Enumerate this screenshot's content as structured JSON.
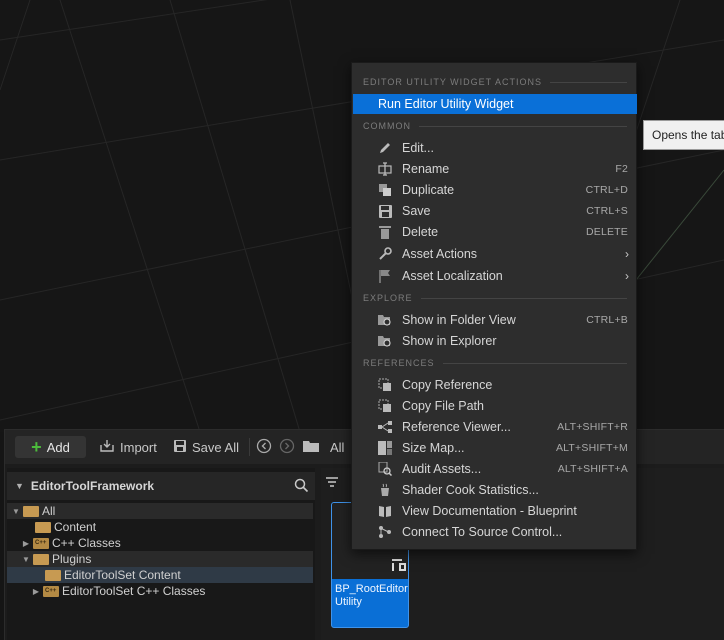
{
  "toolbar": {
    "add_label": "Add",
    "import_label": "Import",
    "save_all_label": "Save All",
    "path_label": "All"
  },
  "tree": {
    "title": "EditorToolFramework",
    "items": [
      {
        "label": "All"
      },
      {
        "label": "Content"
      },
      {
        "label": "C++ Classes"
      },
      {
        "label": "Plugins"
      },
      {
        "label": "EditorToolSet Content"
      },
      {
        "label": "EditorToolSet C++ Classes"
      }
    ]
  },
  "asset": {
    "name": "BP_RootEditorUtility",
    "name_line1": "BP_RootEditor",
    "name_line2": "Utility"
  },
  "menu": {
    "sections": {
      "widget_actions": "EDITOR UTILITY WIDGET ACTIONS",
      "common": "COMMON",
      "explore": "EXPLORE",
      "references": "REFERENCES"
    },
    "run_widget": "Run Editor Utility Widget",
    "common": [
      {
        "label": "Edit...",
        "shortcut": "",
        "icon": "pencil-icon"
      },
      {
        "label": "Rename",
        "shortcut": "F2",
        "icon": "rename-icon"
      },
      {
        "label": "Duplicate",
        "shortcut": "CTRL+D",
        "icon": "duplicate-icon"
      },
      {
        "label": "Save",
        "shortcut": "CTRL+S",
        "icon": "save-icon"
      },
      {
        "label": "Delete",
        "shortcut": "DELETE",
        "icon": "trash-icon"
      },
      {
        "label": "Asset Actions",
        "shortcut": "",
        "icon": "wrench-icon"
      },
      {
        "label": "Asset Localization",
        "shortcut": "",
        "icon": "flag-icon"
      }
    ],
    "explore": [
      {
        "label": "Show in Folder View",
        "shortcut": "CTRL+B",
        "icon": "folder-search-icon"
      },
      {
        "label": "Show in Explorer",
        "shortcut": "",
        "icon": "folder-search-icon"
      }
    ],
    "references": [
      {
        "label": "Copy Reference",
        "shortcut": "",
        "icon": "copy-reference-icon"
      },
      {
        "label": "Copy File Path",
        "shortcut": "",
        "icon": "copy-path-icon"
      },
      {
        "label": "Reference Viewer...",
        "shortcut": "ALT+SHIFT+R",
        "icon": "reference-viewer-icon"
      },
      {
        "label": "Size Map...",
        "shortcut": "ALT+SHIFT+M",
        "icon": "size-map-icon"
      },
      {
        "label": "Audit Assets...",
        "shortcut": "ALT+SHIFT+A",
        "icon": "audit-icon"
      },
      {
        "label": "Shader Cook Statistics...",
        "shortcut": "",
        "icon": "shader-icon"
      },
      {
        "label": "View Documentation - Blueprint",
        "shortcut": "",
        "icon": "book-icon"
      },
      {
        "label": "Connect To Source Control...",
        "shortcut": "",
        "icon": "source-control-icon"
      }
    ]
  },
  "tooltip": {
    "text": "Opens the tab"
  },
  "colors": {
    "highlight": "#0a70d8",
    "add_plus": "#4cbb3c",
    "folder": "#c79a52"
  }
}
